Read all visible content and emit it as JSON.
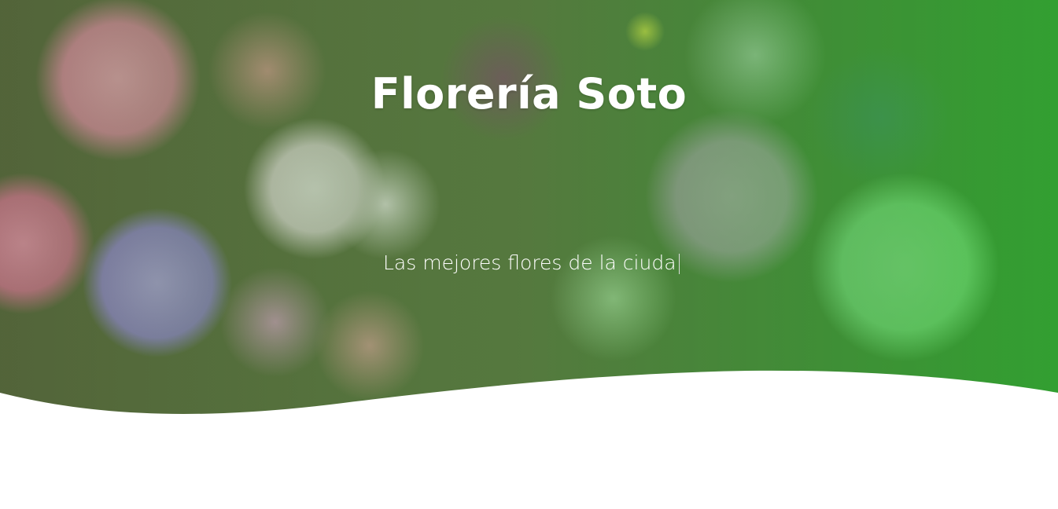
{
  "hero": {
    "title": "Florería Soto",
    "subtitle": "Las mejores flores de la ciuda"
  }
}
